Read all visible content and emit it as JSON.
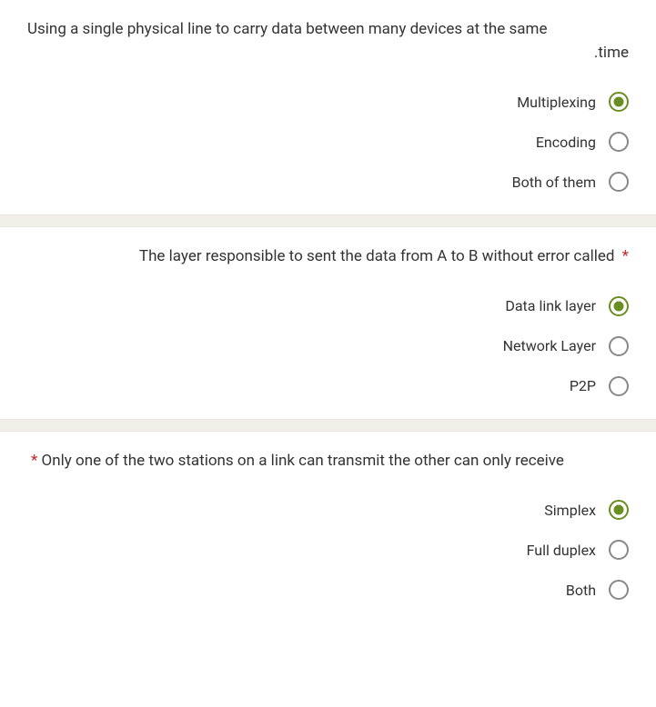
{
  "questions": [
    {
      "required_marker": "",
      "text_line1": "Using a single physical line to carry data between many devices at the same",
      "text_line2": ".time",
      "options": [
        {
          "label": "Multiplexing",
          "selected": true
        },
        {
          "label": "Encoding",
          "selected": false
        },
        {
          "label": "Both of them",
          "selected": false
        }
      ]
    },
    {
      "required_marker": "*",
      "text": "The layer responsible to sent the data from A to B without error called",
      "options": [
        {
          "label": "Data link layer",
          "selected": true
        },
        {
          "label": "Network Layer",
          "selected": false
        },
        {
          "label": "P2P",
          "selected": false
        }
      ]
    },
    {
      "required_marker": "*",
      "text": "Only one of the two stations on a link can transmit the other can only receive",
      "options": [
        {
          "label": "Simplex",
          "selected": true
        },
        {
          "label": "Full duplex",
          "selected": false
        },
        {
          "label": "Both",
          "selected": false
        }
      ]
    }
  ]
}
